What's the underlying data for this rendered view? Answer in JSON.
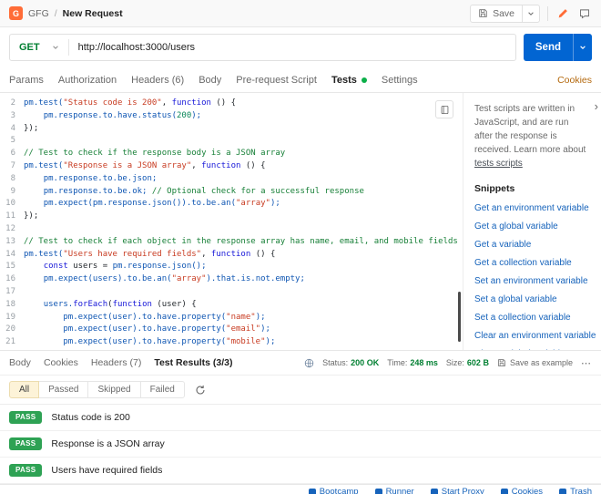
{
  "header": {
    "breadcrumb": [
      "GFG",
      "New Request"
    ],
    "save_label": "Save"
  },
  "request": {
    "method": "GET",
    "url": "http://localhost:3000/users",
    "send_label": "Send",
    "cookies_link": "Cookies",
    "tabs": [
      {
        "label": "Params",
        "active": false,
        "dot": false
      },
      {
        "label": "Authorization",
        "active": false,
        "dot": false
      },
      {
        "label": "Headers (6)",
        "active": false,
        "dot": false
      },
      {
        "label": "Body",
        "active": false,
        "dot": false
      },
      {
        "label": "Pre-request Script",
        "active": false,
        "dot": false
      },
      {
        "label": "Tests",
        "active": true,
        "dot": true
      },
      {
        "label": "Settings",
        "active": false,
        "dot": false
      }
    ]
  },
  "editor": {
    "lines": [
      {
        "num": "2",
        "segs": [
          [
            "v",
            "pm.test("
          ],
          [
            "s",
            "\"Status code is 200\""
          ],
          [
            "p",
            ", "
          ],
          [
            "k",
            "function"
          ],
          [
            "p",
            " () {"
          ]
        ]
      },
      {
        "num": "3",
        "segs": [
          [
            "p",
            "    "
          ],
          [
            "v",
            "pm.response.to.have.status("
          ],
          [
            "n",
            "200"
          ],
          [
            "v",
            ");"
          ]
        ]
      },
      {
        "num": "4",
        "segs": [
          [
            "p",
            "});"
          ]
        ]
      },
      {
        "num": "5",
        "segs": []
      },
      {
        "num": "6",
        "segs": [
          [
            "c",
            "// Test to check if the response body is a JSON array"
          ]
        ]
      },
      {
        "num": "7",
        "segs": [
          [
            "v",
            "pm.test("
          ],
          [
            "s",
            "\"Response is a JSON array\""
          ],
          [
            "p",
            ", "
          ],
          [
            "k",
            "function"
          ],
          [
            "p",
            " () {"
          ]
        ]
      },
      {
        "num": "8",
        "segs": [
          [
            "p",
            "    "
          ],
          [
            "v",
            "pm.response.to.be.json;"
          ]
        ]
      },
      {
        "num": "9",
        "segs": [
          [
            "p",
            "    "
          ],
          [
            "v",
            "pm.response.to.be.ok; "
          ],
          [
            "c",
            "// Optional check for a successful response"
          ]
        ]
      },
      {
        "num": "10",
        "segs": [
          [
            "p",
            "    "
          ],
          [
            "v",
            "pm.expect(pm.response.json()).to.be.an("
          ],
          [
            "s",
            "\"array\""
          ],
          [
            "v",
            ");"
          ]
        ]
      },
      {
        "num": "11",
        "segs": [
          [
            "p",
            "});"
          ]
        ]
      },
      {
        "num": "12",
        "segs": []
      },
      {
        "num": "13",
        "segs": [
          [
            "c",
            "// Test to check if each object in the response array has name, email, and mobile fields"
          ]
        ]
      },
      {
        "num": "14",
        "segs": [
          [
            "v",
            "pm.test("
          ],
          [
            "s",
            "\"Users have required fields\""
          ],
          [
            "p",
            ", "
          ],
          [
            "k",
            "function"
          ],
          [
            "p",
            " () {"
          ]
        ]
      },
      {
        "num": "15",
        "segs": [
          [
            "p",
            "    "
          ],
          [
            "k",
            "const"
          ],
          [
            "p",
            " users = "
          ],
          [
            "v",
            "pm.response.json();"
          ]
        ]
      },
      {
        "num": "16",
        "segs": [
          [
            "p",
            "    "
          ],
          [
            "v",
            "pm.expect(users).to.be.an("
          ],
          [
            "s",
            "\"array\""
          ],
          [
            "v",
            ").that.is.not.empty;"
          ]
        ]
      },
      {
        "num": "17",
        "segs": []
      },
      {
        "num": "18",
        "segs": [
          [
            "p",
            "    "
          ],
          [
            "v",
            "users."
          ],
          [
            "k",
            "forEach"
          ],
          [
            "p",
            "("
          ],
          [
            "k",
            "function"
          ],
          [
            "p",
            " (user) {"
          ]
        ]
      },
      {
        "num": "19",
        "segs": [
          [
            "p",
            "        "
          ],
          [
            "v",
            "pm.expect(user).to.have.property("
          ],
          [
            "s",
            "\"name\""
          ],
          [
            "v",
            ");"
          ]
        ]
      },
      {
        "num": "20",
        "segs": [
          [
            "p",
            "        "
          ],
          [
            "v",
            "pm.expect(user).to.have.property("
          ],
          [
            "s",
            "\"email\""
          ],
          [
            "v",
            ");"
          ]
        ]
      },
      {
        "num": "21",
        "segs": [
          [
            "p",
            "        "
          ],
          [
            "v",
            "pm.expect(user).to.have.property("
          ],
          [
            "s",
            "\"mobile\""
          ],
          [
            "v",
            ");"
          ]
        ]
      }
    ]
  },
  "sidebar": {
    "help_text": "Test scripts are written in JavaScript, and are run after the response is received. Learn more about",
    "help_link": "tests scripts",
    "snippets_title": "Snippets",
    "links": [
      "Get an environment variable",
      "Get a global variable",
      "Get a variable",
      "Get a collection variable",
      "Set an environment variable",
      "Set a global variable",
      "Set a collection variable",
      "Clear an environment variable",
      "Clear a global variable"
    ]
  },
  "response": {
    "tabs": [
      {
        "label": "Body",
        "active": false
      },
      {
        "label": "Cookies",
        "active": false
      },
      {
        "label": "Headers (7)",
        "active": false
      },
      {
        "label": "Test Results (3/3)",
        "active": true
      }
    ],
    "status_label": "Status:",
    "status_value": "200 OK",
    "time_label": "Time:",
    "time_value": "248 ms",
    "size_label": "Size:",
    "size_value": "602 B",
    "save_example_label": "Save as example",
    "more_label": "⋯",
    "filters": [
      {
        "label": "All",
        "active": true
      },
      {
        "label": "Passed",
        "active": false
      },
      {
        "label": "Skipped",
        "active": false
      },
      {
        "label": "Failed",
        "active": false
      }
    ],
    "results": [
      {
        "badge": "PASS",
        "name": "Status code is 200"
      },
      {
        "badge": "PASS",
        "name": "Response is a JSON array"
      },
      {
        "badge": "PASS",
        "name": "Users have required fields"
      }
    ]
  },
  "footer": {
    "items": [
      "Bootcamp",
      "Runner",
      "Start Proxy",
      "Cookies",
      "Trash"
    ]
  },
  "colors": {
    "accent_orange": "#ff6c37",
    "method_green": "#007f31",
    "send_blue": "#0265d2",
    "link_blue": "#1663bb",
    "pass_green": "#2ea254"
  }
}
